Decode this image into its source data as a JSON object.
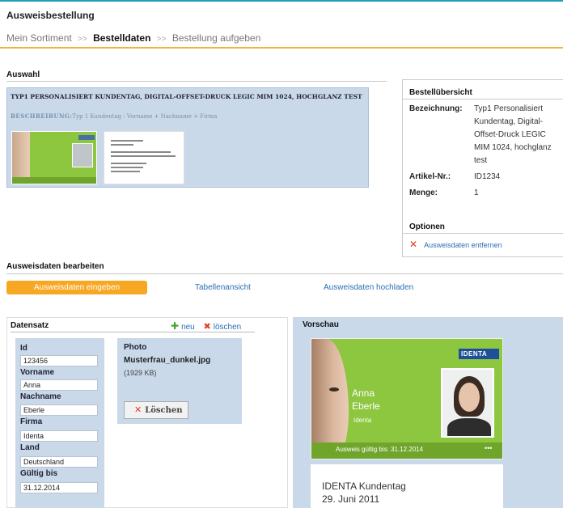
{
  "page": {
    "title": "Ausweisbestellung"
  },
  "breadcrumb": {
    "step1": "Mein Sortiment",
    "sep": ">>",
    "step2": "Bestelldaten",
    "step3": "Bestellung aufgeben"
  },
  "auswahl": {
    "title": "Auswahl",
    "product": "TYP1 PERSONALISIERT KUNDENTAG, DIGITAL-OFFSET-DRUCK LEGIC MIM 1024, HOCHGLANZ TEST",
    "desc_label": "BESCHREIBUNG:",
    "desc_value": "Typ 1 Kundentag : Vorname + Nachname + Firma"
  },
  "summary": {
    "title": "Bestellübersicht",
    "bezeichnung_label": "Bezeichnung:",
    "bezeichnung_value": "Typ1 Personalisiert Kundentag, Digital-Offset-Druck LEGIC MIM 1024, hochglanz test",
    "artikel_label": "Artikel-Nr.:",
    "artikel_value": "ID1234",
    "menge_label": "Menge:",
    "menge_value": "1",
    "options_title": "Optionen",
    "remove_label": "Ausweisdaten entfernen"
  },
  "edit": {
    "title": "Ausweisdaten bearbeiten",
    "tabs": [
      "Ausweisdaten eingeben",
      "Tabellenansicht",
      "Ausweisdaten hochladen"
    ]
  },
  "datensatz": {
    "title": "Datensatz",
    "new_label": "neu",
    "delete_label": "löschen",
    "fields": {
      "id_label": "Id",
      "id_value": "123456",
      "vorname_label": "Vorname",
      "vorname_value": "Anna",
      "nachname_label": "Nachname",
      "nachname_value": "Eberle",
      "firma_label": "Firma",
      "firma_value": "Identa",
      "land_label": "Land",
      "land_value": "Deutschland",
      "gueltig_label": "Gültig bis",
      "gueltig_value": "31.12.2014"
    },
    "photo": {
      "label": "Photo",
      "filename": "Musterfrau_dunkel.jpg",
      "size": "(1929 KB)",
      "delete_button": "Löschen"
    }
  },
  "vorschau": {
    "title": "Vorschau",
    "card": {
      "logo": "IDENTA",
      "firstname": "Anna",
      "lastname": "Eberle",
      "firm": "Identa",
      "valid": "Ausweis gültig bis: 31.12.2014",
      "dots": "•••"
    },
    "back": {
      "line1": "IDENTA Kundentag",
      "line2": "29. Juni 2011"
    }
  },
  "colors": {
    "accent": "#f7a823",
    "panel": "#c9d9ea",
    "card_green": "#8dc63f",
    "link": "#2b6fb2",
    "delete_red": "#e23a2a",
    "add_green": "#4aa33a"
  },
  "icons": [
    "plus-icon",
    "close-icon"
  ]
}
